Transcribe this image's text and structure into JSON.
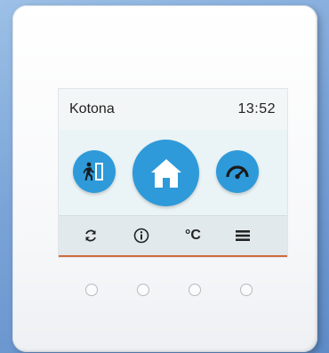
{
  "screen": {
    "zone_name": "Kotona",
    "clock": "13:52"
  },
  "modes": [
    {
      "name": "away",
      "icon": "person-exit-door-icon"
    },
    {
      "name": "home",
      "icon": "house-icon",
      "selected": true
    },
    {
      "name": "boost",
      "icon": "gauge-icon"
    }
  ],
  "bottom_nav": {
    "refresh_icon": "refresh-icon",
    "info_icon": "info-icon",
    "temp_label": "°C",
    "menu_icon": "hamburger-menu-icon"
  },
  "colors": {
    "accent": "#2e9ad9",
    "bottom_bar_accent": "#d06a3a"
  },
  "hardware_buttons": 4
}
